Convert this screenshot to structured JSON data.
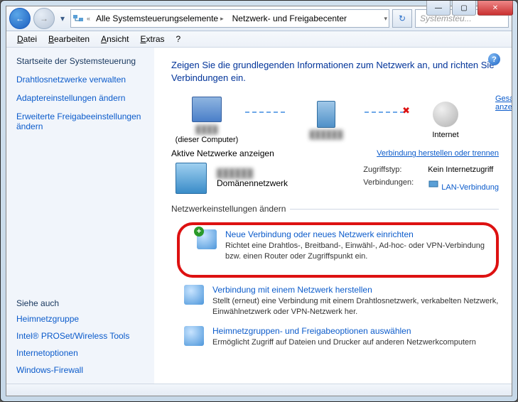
{
  "titlebar": {
    "min": "—",
    "max": "▢",
    "close": "✕"
  },
  "nav": {
    "back": "←",
    "fwd": "→",
    "crumb1": "Alle Systemsteuerungselemente",
    "crumb2": "Netzwerk- und Freigabecenter",
    "search_placeholder": "Systemsteu..."
  },
  "menu": {
    "datei": "Datei",
    "bearbeiten": "Bearbeiten",
    "ansicht": "Ansicht",
    "extras": "Extras",
    "help": "?"
  },
  "sidebar": {
    "home": "Startseite der Systemsteuerung",
    "items": [
      "Drahtlosnetzwerke verwalten",
      "Adaptereinstellungen ändern",
      "Erweiterte Freigabeeinstellungen ändern"
    ],
    "seeAlsoTitle": "Siehe auch",
    "seeAlso": [
      "Heimnetzgruppe",
      "Intel® PROSet/Wireless Tools",
      "Internetoptionen",
      "Windows-Firewall"
    ]
  },
  "main": {
    "heading": "Zeigen Sie die grundlegenden Informationen zum Netzwerk an, und richten Sie Verbindungen ein.",
    "overviewLink": "Gesamtübersicht anzeigen",
    "node1_sub": "(dieser Computer)",
    "node3": "Internet",
    "activeTitle": "Aktive Netzwerke anzeigen",
    "connectLink": "Verbindung herstellen oder trennen",
    "domainLabel": "Domänennetzwerk",
    "props": {
      "k1": "Zugriffstyp:",
      "v1": "Kein Internetzugriff",
      "k2": "Verbindungen:",
      "v2": "LAN-Verbindung"
    },
    "settingsLegend": "Netzwerkeinstellungen ändern",
    "opt1": {
      "t": "Neue Verbindung oder neues Netzwerk einrichten",
      "d": "Richtet eine Drahtlos-, Breitband-, Einwähl-, Ad-hoc- oder VPN-Verbindung bzw. einen Router oder Zugriffspunkt ein."
    },
    "opt2": {
      "t": "Verbindung mit einem Netzwerk herstellen",
      "d": "Stellt (erneut) eine Verbindung mit einem Drahtlosnetzwerk, verkabelten Netzwerk, Einwählnetzwerk oder VPN-Netzwerk her."
    },
    "opt3": {
      "t": "Heimnetzgruppen- und Freigabeoptionen auswählen",
      "d": "Ermöglicht Zugriff auf Dateien und Drucker auf anderen Netzwerkcomputern"
    }
  }
}
